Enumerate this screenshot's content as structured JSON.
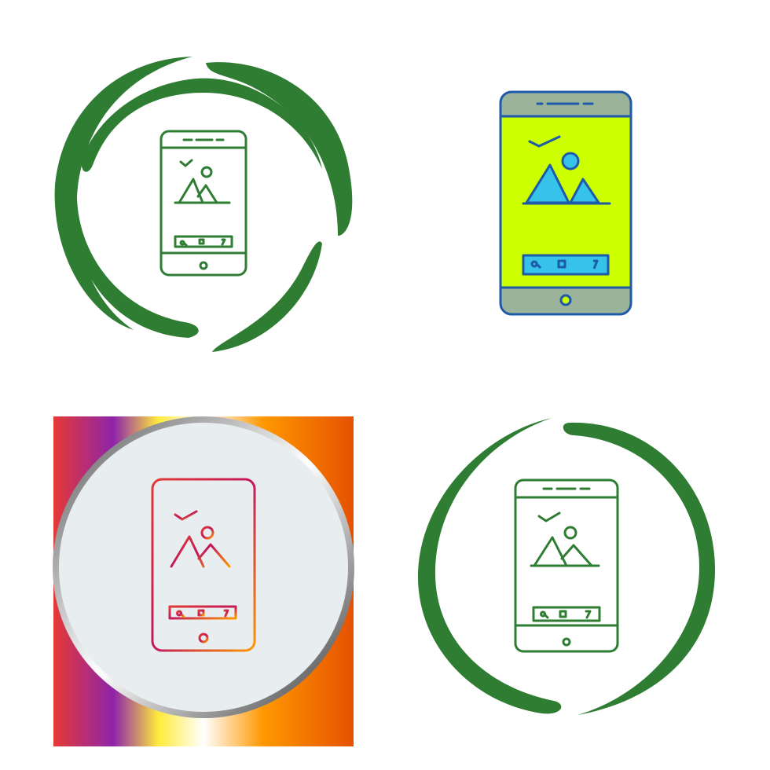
{
  "colors": {
    "background": "#ffffff",
    "green": "#2e7d32",
    "lime": "#ccff00",
    "blue_outline": "#1e5aa8",
    "grey_frame": "#9bb39b",
    "cyan_bar": "#37c2ea",
    "gradient_stops": [
      "#e53935",
      "#8e24aa",
      "#ffeb3b",
      "#ffffff",
      "#ff9800",
      "#e65100"
    ],
    "light_circle": "#e8eef0"
  },
  "icons": [
    {
      "style": "green-outline-orbit",
      "glyph": "smartphone-gallery-icon"
    },
    {
      "style": "filled-color",
      "glyph": "smartphone-gallery-icon"
    },
    {
      "style": "gradient-square-badge",
      "glyph": "smartphone-gallery-icon"
    },
    {
      "style": "green-outline-ring",
      "glyph": "smartphone-gallery-icon"
    }
  ]
}
